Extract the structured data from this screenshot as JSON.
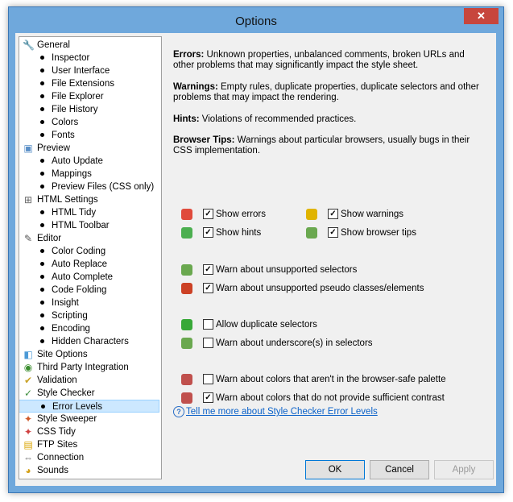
{
  "window": {
    "title": "Options"
  },
  "tree": [
    {
      "label": "General",
      "level": 0,
      "icon": "wrench-icon",
      "glyph": "🔧",
      "color": "#7a7a7a"
    },
    {
      "label": "Inspector",
      "level": 1
    },
    {
      "label": "User Interface",
      "level": 1
    },
    {
      "label": "File Extensions",
      "level": 1
    },
    {
      "label": "File Explorer",
      "level": 1
    },
    {
      "label": "File History",
      "level": 1
    },
    {
      "label": "Colors",
      "level": 1
    },
    {
      "label": "Fonts",
      "level": 1
    },
    {
      "label": "Preview",
      "level": 0,
      "icon": "preview-icon",
      "glyph": "▣",
      "color": "#5a8fc7"
    },
    {
      "label": "Auto Update",
      "level": 1
    },
    {
      "label": "Mappings",
      "level": 1
    },
    {
      "label": "Preview Files (CSS only)",
      "level": 1
    },
    {
      "label": "HTML Settings",
      "level": 0,
      "icon": "html-icon",
      "glyph": "⊞",
      "color": "#666666"
    },
    {
      "label": "HTML Tidy",
      "level": 1
    },
    {
      "label": "HTML Toolbar",
      "level": 1
    },
    {
      "label": "Editor",
      "level": 0,
      "icon": "editor-icon",
      "glyph": "✎",
      "color": "#555555"
    },
    {
      "label": "Color Coding",
      "level": 1
    },
    {
      "label": "Auto Replace",
      "level": 1
    },
    {
      "label": "Auto Complete",
      "level": 1
    },
    {
      "label": "Code Folding",
      "level": 1
    },
    {
      "label": "Insight",
      "level": 1
    },
    {
      "label": "Scripting",
      "level": 1
    },
    {
      "label": "Encoding",
      "level": 1
    },
    {
      "label": "Hidden Characters",
      "level": 1
    },
    {
      "label": "Site Options",
      "level": 0,
      "icon": "site-icon",
      "glyph": "◧",
      "color": "#4c9ad6"
    },
    {
      "label": "Third Party Integration",
      "level": 0,
      "icon": "integration-icon",
      "glyph": "◉",
      "color": "#3b8d2e"
    },
    {
      "label": "Validation",
      "level": 0,
      "icon": "validation-icon",
      "glyph": "✔",
      "color": "#c9a227"
    },
    {
      "label": "Style Checker",
      "level": 0,
      "icon": "style-checker-icon",
      "glyph": "✓",
      "color": "#3f8f3f"
    },
    {
      "label": "Error Levels",
      "level": 1,
      "selected": true
    },
    {
      "label": "Style Sweeper",
      "level": 0,
      "icon": "sweeper-icon",
      "glyph": "✦",
      "color": "#d05a2a"
    },
    {
      "label": "CSS Tidy",
      "level": 0,
      "icon": "css-tidy-icon",
      "glyph": "✦",
      "color": "#d04040"
    },
    {
      "label": "FTP Sites",
      "level": 0,
      "icon": "ftp-icon",
      "glyph": "▤",
      "color": "#d9a400"
    },
    {
      "label": "Connection",
      "level": 0,
      "icon": "connection-icon",
      "glyph": "⇔",
      "color": "#777777"
    },
    {
      "label": "Sounds",
      "level": 0,
      "icon": "sounds-icon",
      "glyph": "◕",
      "color": "#d4a017"
    }
  ],
  "descriptions": [
    {
      "term": "Errors:",
      "text": " Unknown properties, unbalanced comments, broken URLs and other problems that may significantly impact the style sheet."
    },
    {
      "term": "Warnings:",
      "text": " Empty rules, duplicate properties, duplicate selectors and other problems that may impact the rendering."
    },
    {
      "term": "Hints:",
      "text": " Violations of recommended practices."
    },
    {
      "term": "Browser Tips:",
      "text": " Warnings about particular browsers, usually bugs in their CSS implementation."
    }
  ],
  "options": {
    "show_errors": {
      "label": "Show errors",
      "checked": true,
      "icon": "error-icon",
      "color": "#e04b3c"
    },
    "show_warnings": {
      "label": "Show warnings",
      "checked": true,
      "icon": "warning-icon",
      "color": "#e0b400"
    },
    "show_hints": {
      "label": "Show hints",
      "checked": true,
      "icon": "hint-icon",
      "color": "#4caf50"
    },
    "show_browser_tips": {
      "label": "Show browser tips",
      "checked": true,
      "icon": "browser-tip-icon",
      "color": "#6aa84f"
    },
    "warn_unsupported_selectors": {
      "label": "Warn about unsupported selectors",
      "checked": true,
      "icon": "selector-warning-icon",
      "color": "#6aa84f"
    },
    "warn_unsupported_pseudo": {
      "label": "Warn about unsupported pseudo classes/elements",
      "checked": true,
      "icon": "pseudo-warning-icon",
      "color": "#cc4125"
    },
    "allow_duplicate_selectors": {
      "label": "Allow duplicate selectors",
      "checked": false,
      "icon": "duplicate-icon",
      "color": "#38a838"
    },
    "warn_underscore_selectors": {
      "label": "Warn about underscore(s) in selectors",
      "checked": false,
      "icon": "underscore-warning-icon",
      "color": "#6aa84f"
    },
    "warn_browser_safe_colors": {
      "label": "Warn about colors that aren't in the browser-safe palette",
      "checked": false,
      "icon": "palette-icon",
      "color": "#c0504d"
    },
    "warn_contrast_colors": {
      "label": "Warn about colors that do not provide sufficient contrast",
      "checked": true,
      "icon": "contrast-icon",
      "color": "#c0504d"
    }
  },
  "help_link": "Tell me more about Style Checker Error Levels",
  "buttons": {
    "ok": "OK",
    "cancel": "Cancel",
    "apply": "Apply"
  }
}
